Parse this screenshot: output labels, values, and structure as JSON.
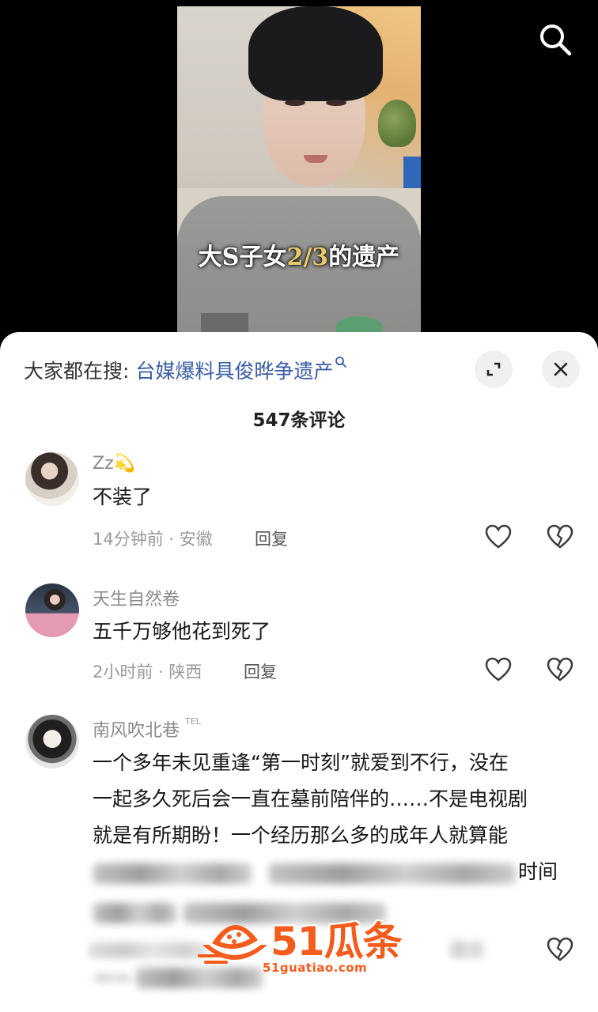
{
  "video": {
    "caption_part1": "大S子女",
    "caption_highlight": "2/3",
    "caption_part2": "的遗产",
    "search_icon": "search-icon"
  },
  "panel": {
    "search_hint_label": "大家都在搜:",
    "search_hint_link": "台媒爆料具俊晔争遗产",
    "expand_icon": "expand-icon",
    "close_icon": "close-icon",
    "comment_count": "547条评论"
  },
  "comments": [
    {
      "user": "Zz💫",
      "text": "不装了",
      "time": "14分钟前",
      "location": "安徽",
      "reply_label": "回复"
    },
    {
      "user": "天生自然卷",
      "text": "五千万够他花到死了",
      "time": "2小时前",
      "location": "陕西",
      "reply_label": "回复"
    },
    {
      "user": "南风吹北巷",
      "badge": "TEL",
      "lines": [
        "一个多年未见重逢“第一时刻”就爱到不行，没在",
        "一起多久死后会一直在墓前陪伴的……不是电视剧",
        "就是有所期盼！一个经历那么多的成年人就算能"
      ],
      "tail_text": "时间"
    }
  ],
  "watermark": {
    "brand": "51瓜条",
    "url": "51guatiao.com"
  },
  "colors": {
    "link": "#3a5da5",
    "watermark": "#f35c1c"
  }
}
